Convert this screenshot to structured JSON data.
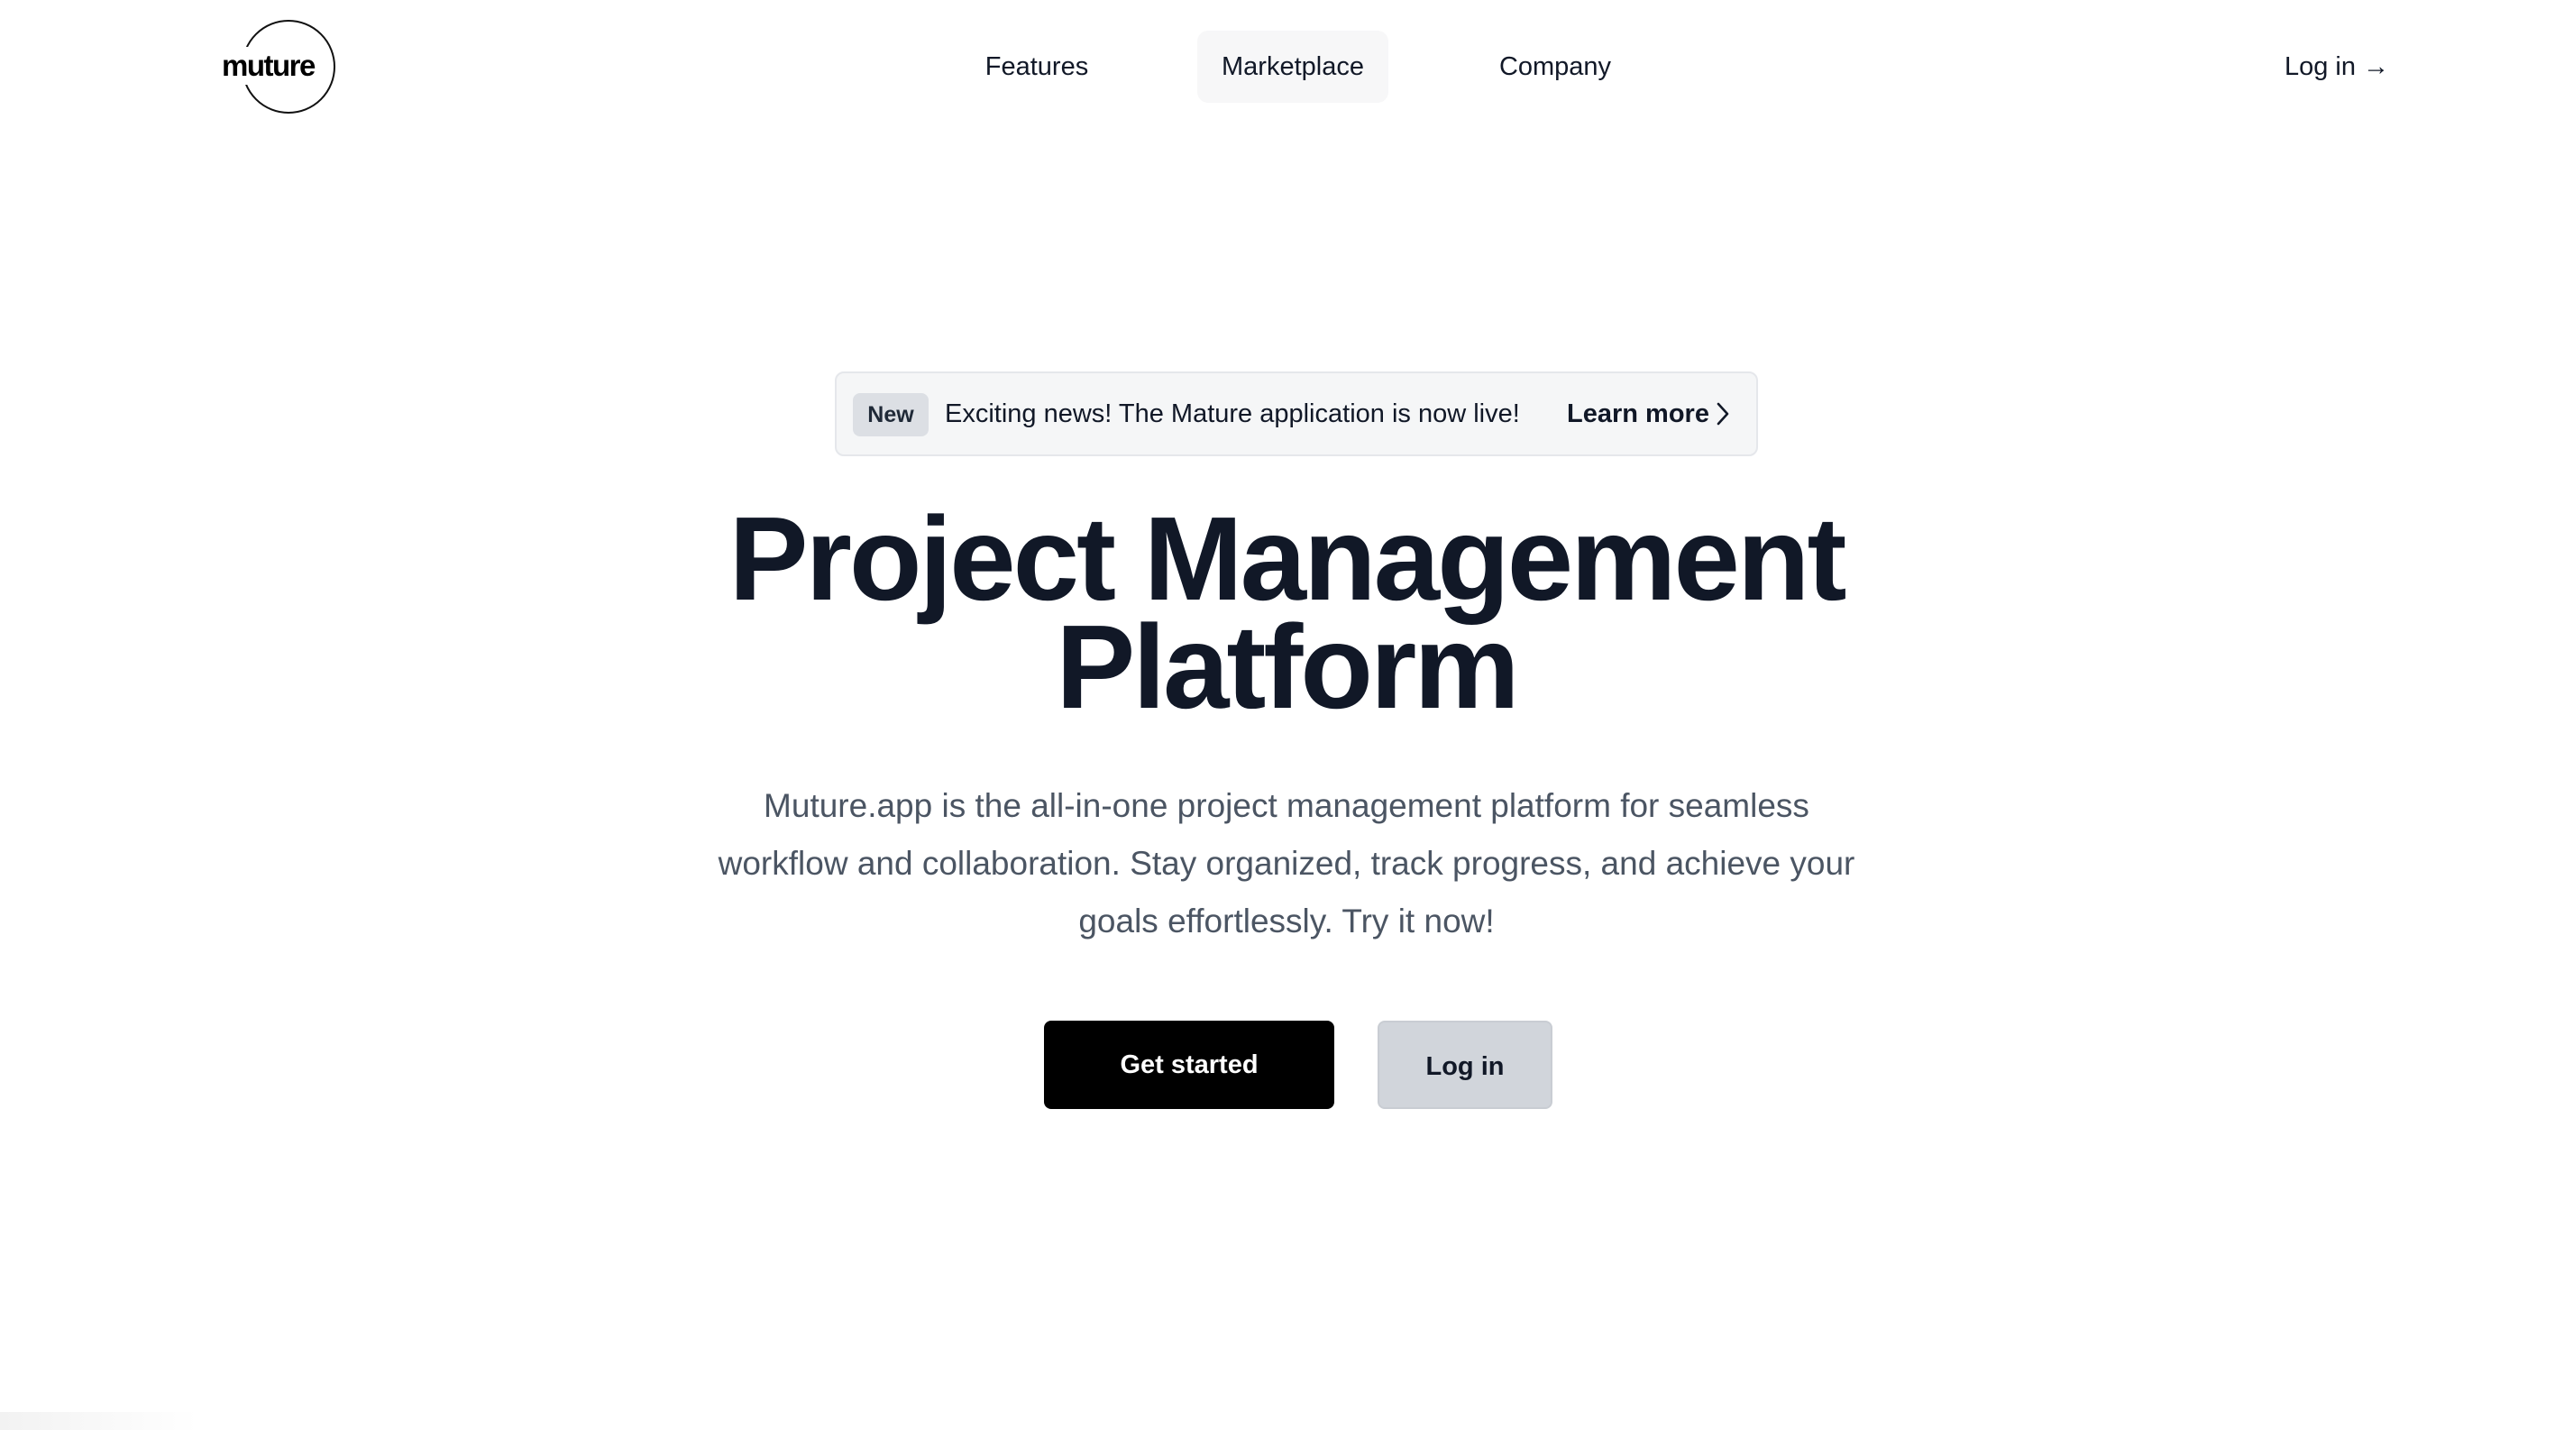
{
  "header": {
    "logo_text": "muture",
    "nav": [
      {
        "label": "Features"
      },
      {
        "label": "Marketplace"
      },
      {
        "label": "Company"
      }
    ],
    "login_label": "Log in",
    "login_arrow": "→"
  },
  "announcement": {
    "badge": "New",
    "text": "Exciting news! The Mature application is now live!",
    "link_label": "Learn more"
  },
  "hero": {
    "title_line1": "Project Management",
    "title_line2": "Platform",
    "subtitle_line1": "Muture.app is the all-in-one project management platform for seamless",
    "subtitle_line2": "workflow and collaboration. Stay organized, track progress, and achieve your",
    "subtitle_line3": "goals effortlessly. Try it now!"
  },
  "cta": {
    "primary_label": "Get started",
    "secondary_label": "Log in"
  },
  "colors": {
    "text": "#111827",
    "muted": "#4b5563",
    "primary_button": "#000000",
    "secondary_button": "#d1d5db",
    "announcement_bg": "#f5f6f7"
  }
}
